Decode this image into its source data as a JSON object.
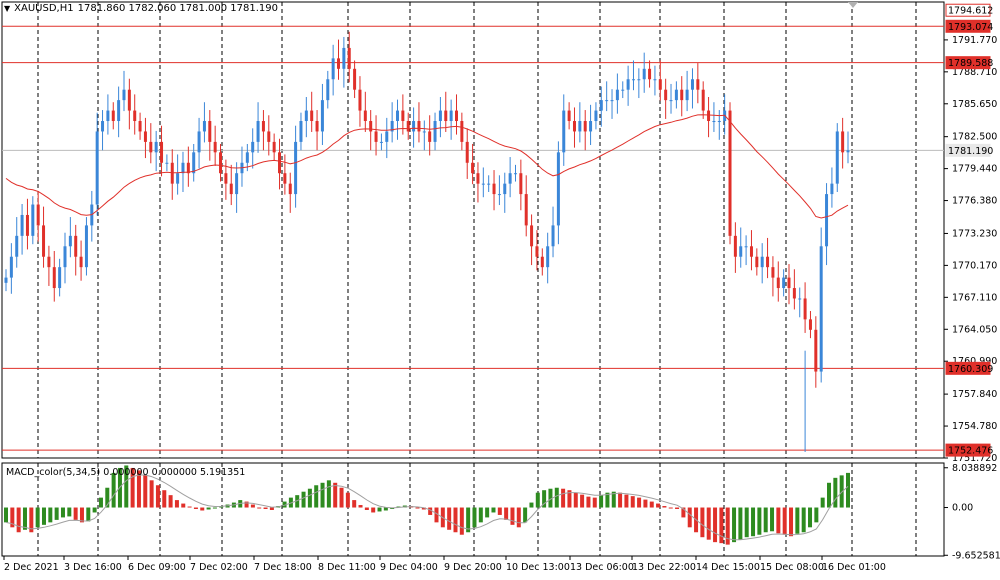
{
  "header": {
    "symbol_tf": "XAUUSD,H1",
    "ohlc": "1781.860 1782.060 1781.000 1781.190",
    "macd_label": "MACD_color(5,34,5) 0.000000 0.000000 5.191351"
  },
  "price_axis": {
    "ticks": [
      "1791.770",
      "1788.710",
      "1785.650",
      "1782.500",
      "1779.440",
      "1776.380",
      "1773.230",
      "1770.170",
      "1767.110",
      "1764.050",
      "1760.990",
      "1757.840",
      "1754.780",
      "1751.720"
    ]
  },
  "levels": [
    {
      "label": "1794.612",
      "kind": "box-white"
    },
    {
      "label": "1793.074",
      "kind": "box-red"
    },
    {
      "label": "1789.588",
      "kind": "box-red"
    },
    {
      "label": "1781.190",
      "kind": "box-grey"
    },
    {
      "label": "1760.309",
      "kind": "box-red"
    },
    {
      "label": "1752.476",
      "kind": "box-red"
    }
  ],
  "macd_axis": {
    "ticks": [
      "8.038892",
      "0.00",
      "-9.652581"
    ]
  },
  "time_axis": {
    "ticks": [
      "2 Dec 2021",
      "3 Dec 16:00",
      "6 Dec 09:00",
      "7 Dec 02:00",
      "7 Dec 18:00",
      "8 Dec 11:00",
      "9 Dec 04:00",
      "9 Dec 20:00",
      "10 Dec 13:00",
      "13 Dec 06:00",
      "13 Dec 22:00",
      "14 Dec 15:00",
      "15 Dec 08:00",
      "16 Dec 01:00"
    ]
  },
  "colors": {
    "bull": "#3a86d8",
    "bear": "#e0302a",
    "ma": "#e0302a",
    "hist_up": "#2e8b20",
    "hist_dn": "#e0302a",
    "signal": "#a0a0a0",
    "grid": "#000000"
  },
  "chart_data": {
    "type": "candlestick",
    "title": "XAUUSD,H1",
    "ylim": [
      1751.72,
      1795.4
    ],
    "closes": [
      1769,
      1771,
      1773,
      1775,
      1773,
      1776,
      1774,
      1771,
      1770,
      1768,
      1770,
      1772,
      1773,
      1771,
      1770,
      1774,
      1776,
      1783,
      1784,
      1785,
      1784,
      1786,
      1787,
      1785,
      1784,
      1783,
      1782,
      1781,
      1782,
      1780,
      1780,
      1778,
      1779,
      1780,
      1779,
      1781,
      1783,
      1784,
      1782,
      1781,
      1779,
      1778,
      1777,
      1779,
      1780,
      1781,
      1782,
      1784,
      1783,
      1782,
      1781,
      1779,
      1778,
      1777,
      1782,
      1784,
      1785,
      1784,
      1783,
      1786,
      1788,
      1790,
      1789,
      1791,
      1789,
      1787,
      1785,
      1784,
      1783,
      1782,
      1782,
      1783,
      1784,
      1785,
      1784,
      1783,
      1784,
      1783,
      1783,
      1782,
      1784,
      1785,
      1784,
      1785,
      1784,
      1782,
      1780,
      1779,
      1778,
      1778,
      1778,
      1777,
      1777,
      1778,
      1779,
      1779,
      1777,
      1774,
      1772,
      1771,
      1770,
      1772,
      1774,
      1781,
      1785,
      1784,
      1783,
      1784,
      1783,
      1784,
      1785,
      1786,
      1786,
      1786,
      1787,
      1787,
      1788,
      1788,
      1788,
      1789,
      1788,
      1788,
      1787,
      1786,
      1786,
      1787,
      1786,
      1787,
      1788,
      1787,
      1785,
      1784,
      1784,
      1784,
      1785,
      1773,
      1771,
      1772,
      1772,
      1771,
      1770,
      1771,
      1770,
      1769,
      1768,
      1769,
      1768,
      1767,
      1767,
      1765,
      1764,
      1760,
      1772,
      1777,
      1778,
      1783,
      1781,
      1781.19
    ]
  },
  "macd_data": {
    "values": [
      -3,
      -4,
      -5,
      -4.5,
      -5,
      -4,
      -3.5,
      -3,
      -2.5,
      -2,
      -1.8,
      -2.5,
      -3,
      -2.8,
      -1,
      2,
      4,
      7,
      8,
      8.5,
      8,
      7.5,
      6.5,
      5.5,
      4.5,
      3.5,
      2.5,
      1.5,
      0.8,
      0.2,
      -0.3,
      -0.6,
      -0.4,
      -0.2,
      0.3,
      0.6,
      1,
      1.5,
      1.2,
      0.6,
      0,
      -0.3,
      -0.5,
      0.3,
      1.2,
      2,
      2.5,
      3.2,
      3.8,
      4.5,
      5,
      5.5,
      5,
      4,
      3,
      1.5,
      0.5,
      -0.5,
      -1,
      -0.8,
      -0.6,
      -0.3,
      0.2,
      0.4,
      0.3,
      0,
      -0.4,
      -1.5,
      -3,
      -4,
      -4.5,
      -5,
      -5.5,
      -5,
      -4,
      -3,
      -2,
      -1,
      -1.5,
      -2.5,
      -3.5,
      -4,
      -3,
      1,
      3,
      3.5,
      3.8,
      4,
      3.8,
      3.5,
      3,
      2.6,
      2.2,
      2,
      2.5,
      3,
      3.2,
      3,
      2.6,
      2.3,
      2,
      1.6,
      1.2,
      0.8,
      0.3,
      -0.1,
      -0.3,
      -2,
      -4,
      -5,
      -6,
      -6.5,
      -7,
      -7.2,
      -7.5,
      -7,
      -6.5,
      -6,
      -5.8,
      -5.5,
      -5,
      -4.8,
      -5.2,
      -5.5,
      -5.8,
      -5.3,
      -5,
      -4,
      -3,
      2,
      5,
      6,
      6.5,
      7
    ]
  }
}
